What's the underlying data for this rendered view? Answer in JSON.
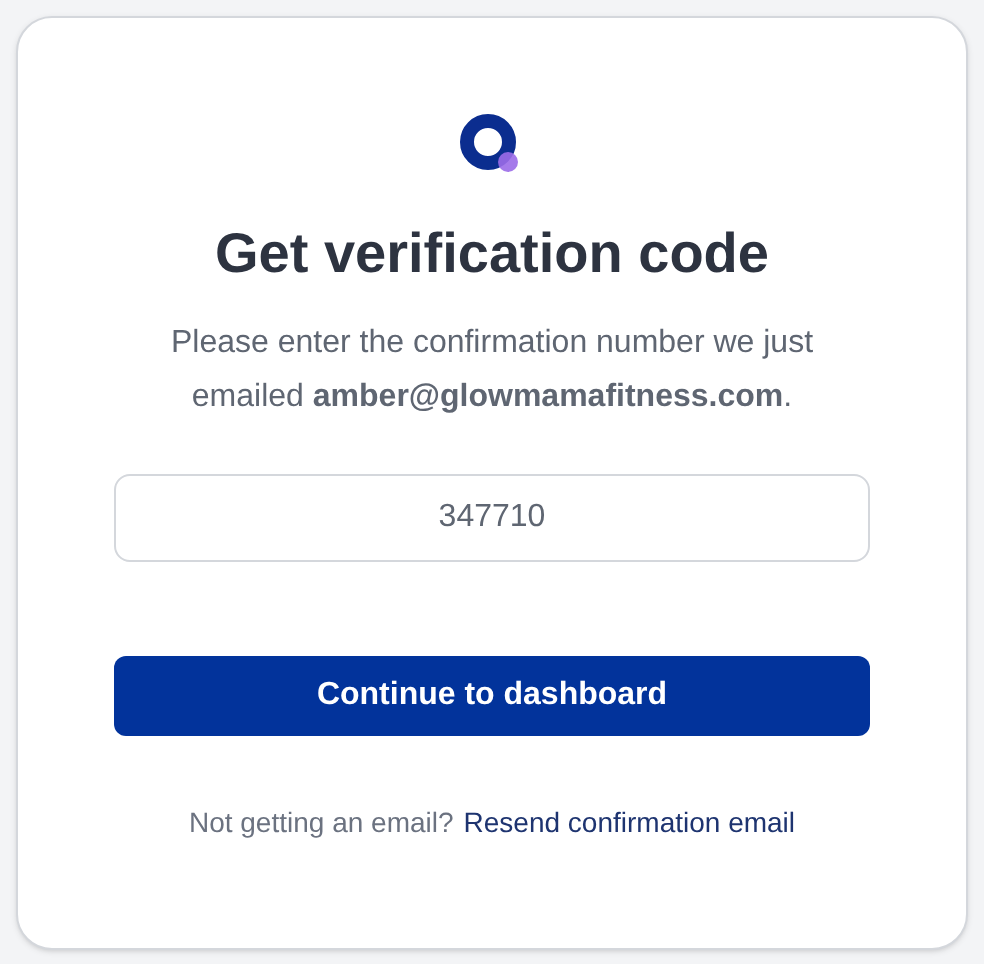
{
  "title": "Get verification code",
  "message": "Please enter the confirmation number we just emailed **amber@glowmamafitness.com**.",
  "code_field": {
    "value": "347710"
  },
  "submit_button": "Continue to dashboard",
  "footer": {
    "text": "Not getting an email?",
    "link": "Resend confirmation email"
  }
}
